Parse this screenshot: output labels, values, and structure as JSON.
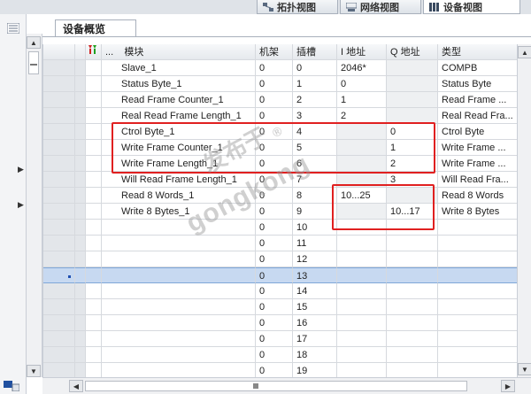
{
  "view_tabs": [
    {
      "label": "拓扑视图",
      "icon": "topology-icon",
      "active": false
    },
    {
      "label": "网络视图",
      "icon": "network-icon",
      "active": false
    },
    {
      "label": "设备视图",
      "icon": "device-icon",
      "active": true
    }
  ],
  "overview_tab": "设备概览",
  "table": {
    "headers": {
      "module": "模块",
      "rack": "机架",
      "slot": "插槽",
      "i_addr": "I 地址",
      "q_addr": "Q 地址",
      "type": "类型",
      "more": "..."
    },
    "rows": [
      {
        "module": "Slave_1",
        "rack": "0",
        "slot": "0",
        "i_addr": "2046*",
        "q_addr": "",
        "type": "COMPB"
      },
      {
        "module": "Status Byte_1",
        "rack": "0",
        "slot": "1",
        "i_addr": "0",
        "q_addr": "",
        "type": "Status Byte"
      },
      {
        "module": "Read Frame Counter_1",
        "rack": "0",
        "slot": "2",
        "i_addr": "1",
        "q_addr": "",
        "type": "Read Frame ..."
      },
      {
        "module": "Real Read Frame Length_1",
        "rack": "0",
        "slot": "3",
        "i_addr": "2",
        "q_addr": "",
        "type": "Real Read Fra..."
      },
      {
        "module": "Ctrol Byte_1",
        "rack": "0",
        "slot": "4",
        "i_addr": "",
        "q_addr": "0",
        "type": "Ctrol Byte"
      },
      {
        "module": "Write Frame Counter_1",
        "rack": "0",
        "slot": "5",
        "i_addr": "",
        "q_addr": "1",
        "type": "Write Frame ..."
      },
      {
        "module": "Write Frame Length_1",
        "rack": "0",
        "slot": "6",
        "i_addr": "",
        "q_addr": "2",
        "type": "Write Frame ..."
      },
      {
        "module": "Will Read Frame Length_1",
        "rack": "0",
        "slot": "7",
        "i_addr": "",
        "q_addr": "3",
        "type": "Will Read Fra..."
      },
      {
        "module": "Read 8 Words_1",
        "rack": "0",
        "slot": "8",
        "i_addr": "10...25",
        "q_addr": "",
        "type": "Read 8 Words"
      },
      {
        "module": "Write 8 Bytes_1",
        "rack": "0",
        "slot": "9",
        "i_addr": "",
        "q_addr": "10...17",
        "type": "Write 8 Bytes"
      },
      {
        "module": "",
        "rack": "0",
        "slot": "10",
        "i_addr": "",
        "q_addr": "",
        "type": ""
      },
      {
        "module": "",
        "rack": "0",
        "slot": "11",
        "i_addr": "",
        "q_addr": "",
        "type": ""
      },
      {
        "module": "",
        "rack": "0",
        "slot": "12",
        "i_addr": "",
        "q_addr": "",
        "type": ""
      },
      {
        "module": "",
        "rack": "0",
        "slot": "13",
        "i_addr": "",
        "q_addr": "",
        "type": ""
      },
      {
        "module": "",
        "rack": "0",
        "slot": "14",
        "i_addr": "",
        "q_addr": "",
        "type": ""
      },
      {
        "module": "",
        "rack": "0",
        "slot": "15",
        "i_addr": "",
        "q_addr": "",
        "type": ""
      },
      {
        "module": "",
        "rack": "0",
        "slot": "16",
        "i_addr": "",
        "q_addr": "",
        "type": ""
      },
      {
        "module": "",
        "rack": "0",
        "slot": "17",
        "i_addr": "",
        "q_addr": "",
        "type": ""
      },
      {
        "module": "",
        "rack": "0",
        "slot": "18",
        "i_addr": "",
        "q_addr": "",
        "type": ""
      },
      {
        "module": "",
        "rack": "0",
        "slot": "19",
        "i_addr": "",
        "q_addr": "",
        "type": ""
      }
    ],
    "selected_row": 13
  },
  "watermark": {
    "line1": "发布于",
    "line2": "gongkong",
    "mark": "®"
  },
  "colors": {
    "highlight_box": "#e02020",
    "selection": "#c7d9f1"
  }
}
